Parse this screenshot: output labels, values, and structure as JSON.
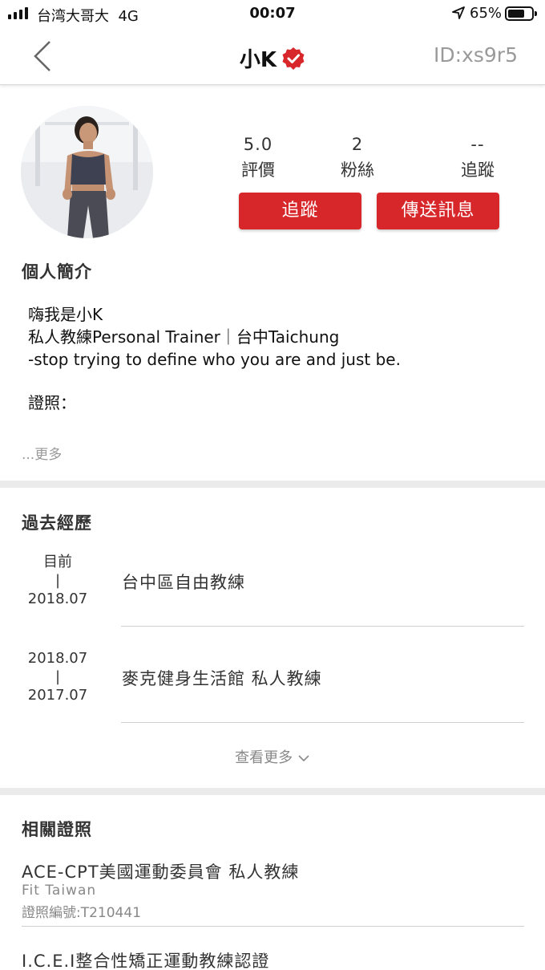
{
  "status_bar": {
    "carrier": "台湾大哥大",
    "network": "4G",
    "time": "00:07",
    "battery": "65%"
  },
  "nav": {
    "title": "小K",
    "user_id": "ID:xs9r5"
  },
  "profile": {
    "stats": [
      {
        "value": "5.0",
        "label": "評價"
      },
      {
        "value": "2",
        "label": "粉絲"
      },
      {
        "value": "--",
        "label": "追蹤"
      }
    ],
    "follow_button": "追蹤",
    "message_button": "傳送訊息"
  },
  "bio": {
    "heading": "個人簡介",
    "line1": "嗨我是小K",
    "line2": "私人教練Personal Trainer｜台中Taichung",
    "line3": "-stop trying to define who you are and just be.",
    "line4": "證照：",
    "more": "...更多"
  },
  "experience": {
    "heading": "過去經歷",
    "items": [
      {
        "date_top": "目前",
        "sep": "|",
        "date_bottom": "2018.07",
        "title": "台中區自由教練"
      },
      {
        "date_top": "2018.07",
        "sep": "|",
        "date_bottom": "2017.07",
        "title": "麥克健身生活館 私人教練"
      }
    ],
    "see_more": "查看更多"
  },
  "certifications": {
    "heading": "相關證照",
    "items": [
      {
        "name": "ACE-CPT美國運動委員會 私人教練",
        "org": "Fit Taiwan",
        "number": "證照編號:T210441"
      },
      {
        "name": "I.C.E.I整合性矯正運動教練認證"
      }
    ]
  },
  "colors": {
    "accent": "#d8272b",
    "divider": "#ebebeb"
  }
}
